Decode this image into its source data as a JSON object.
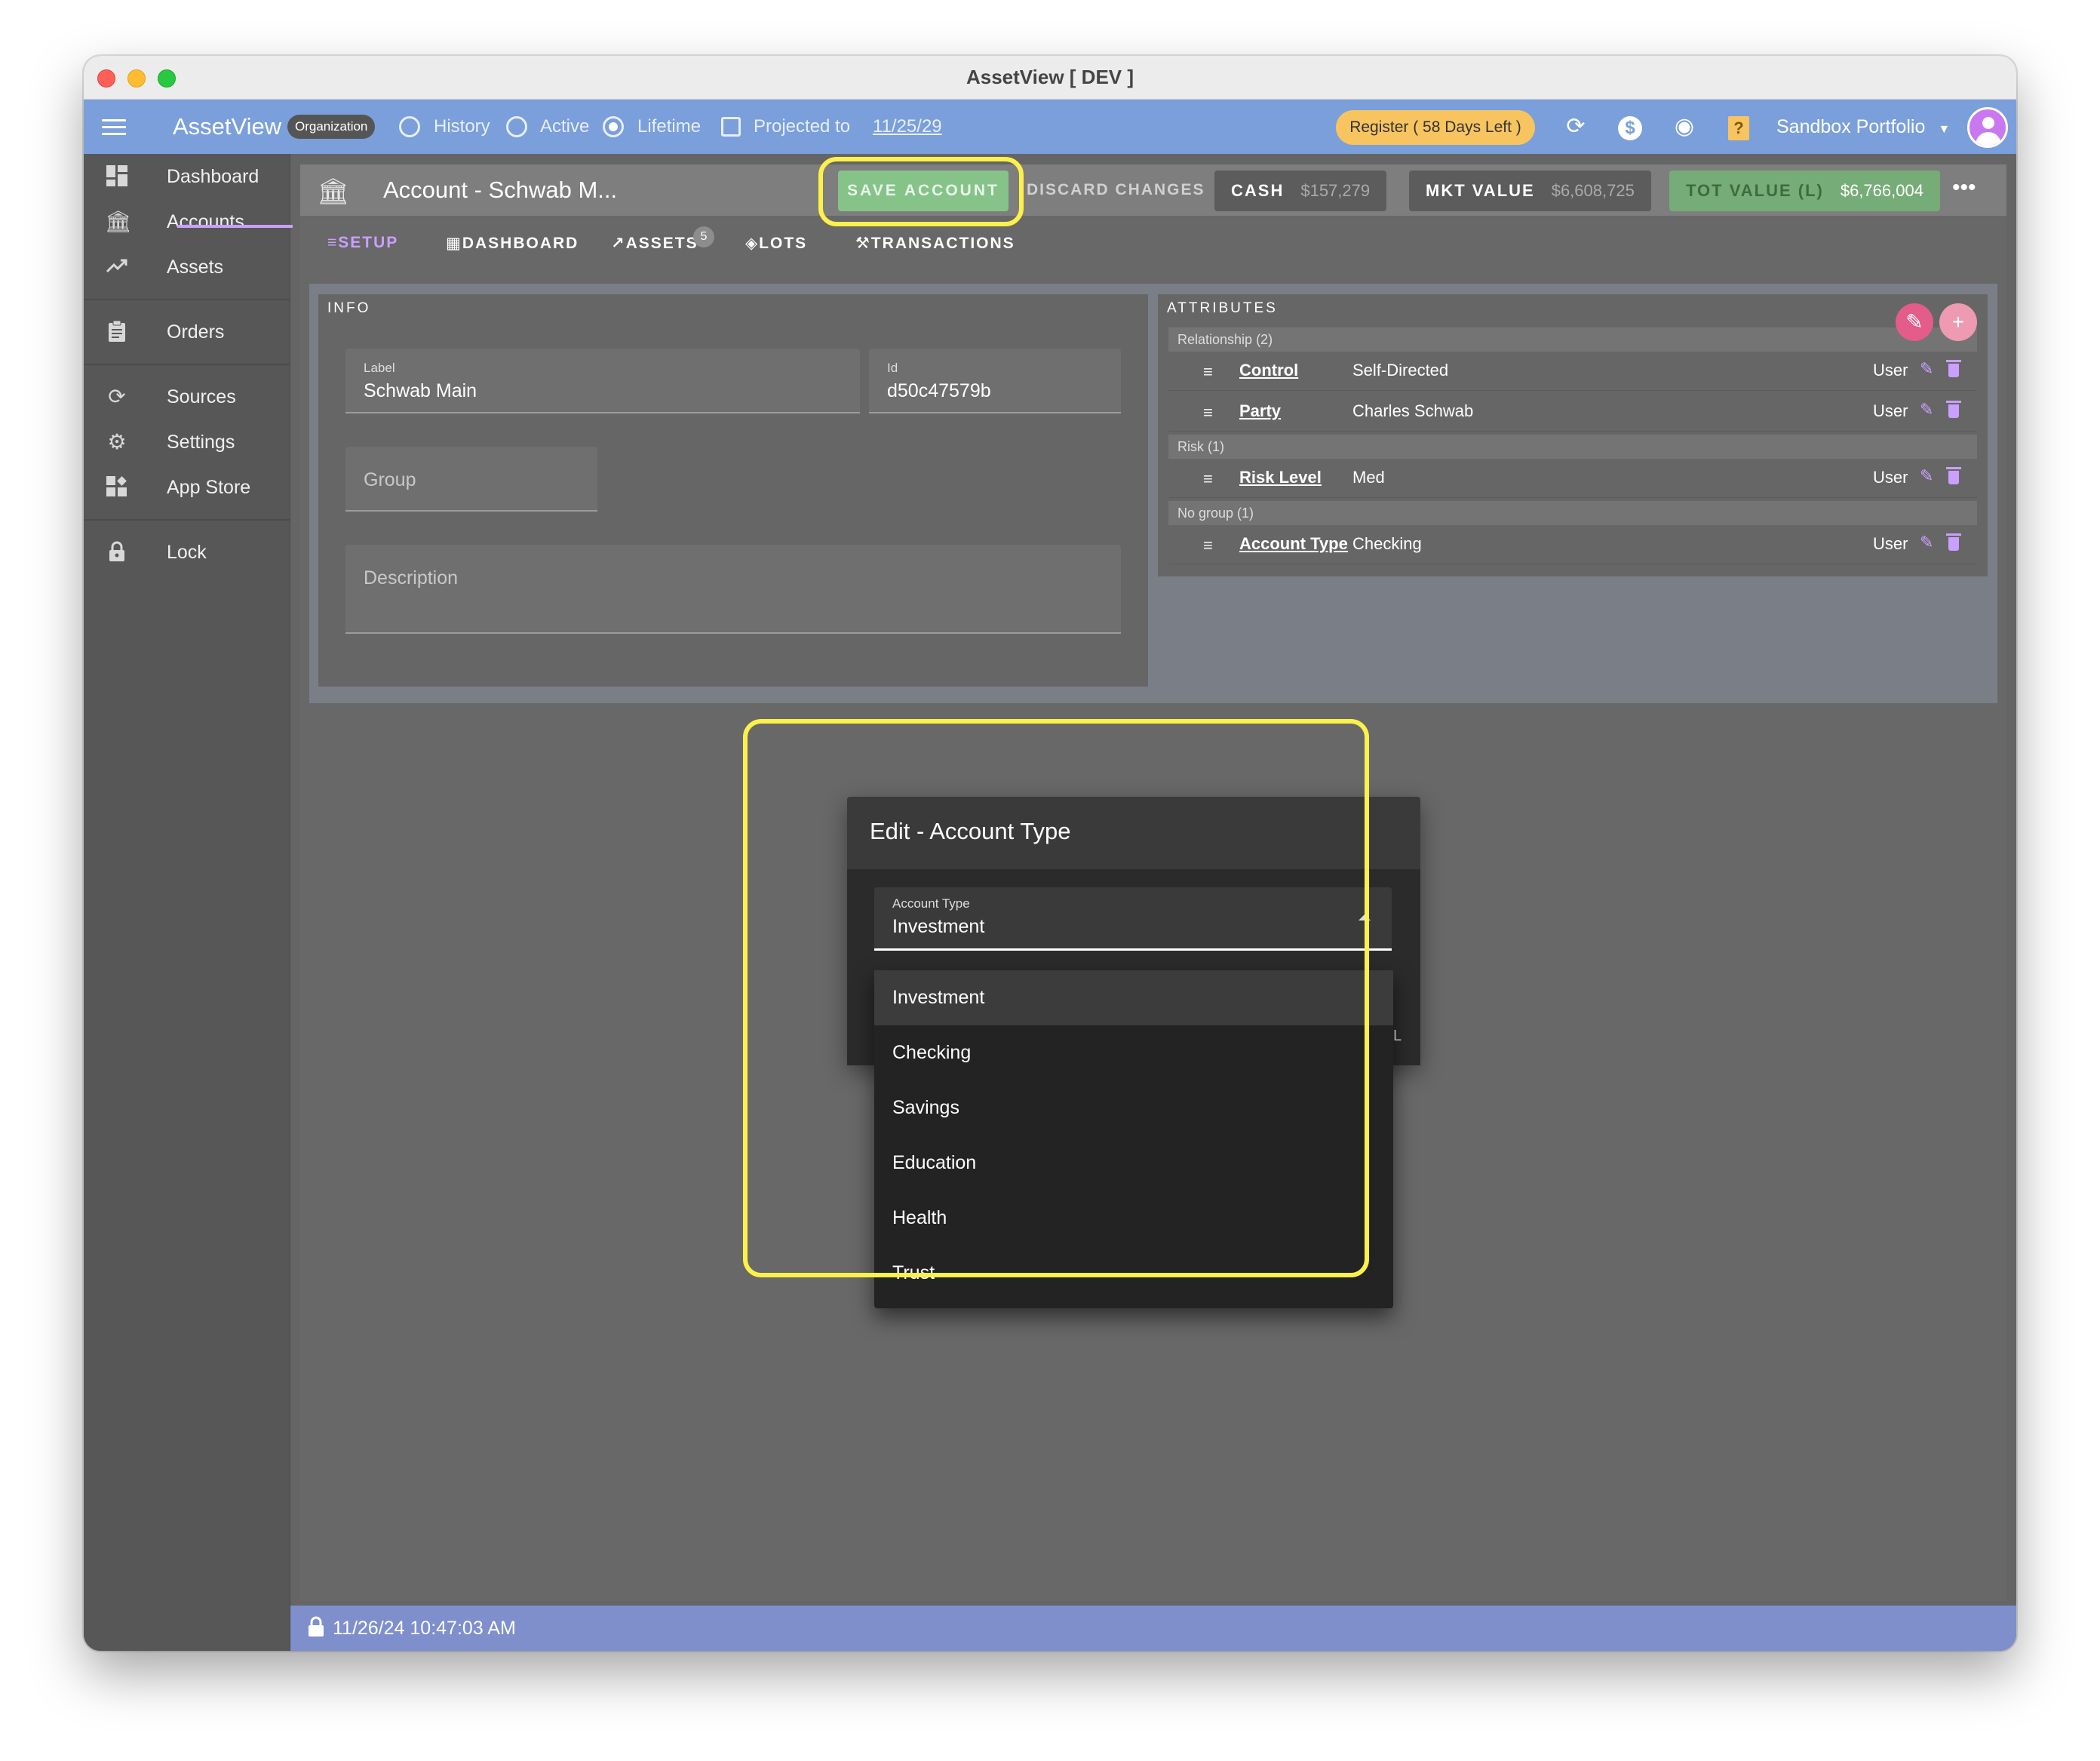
{
  "window": {
    "title": "AssetView [ DEV ]"
  },
  "appbar": {
    "brand": "AssetView",
    "org_chip": "Organization",
    "history": "History",
    "active": "Active",
    "lifetime": "Lifetime",
    "projected": "Projected to",
    "projected_date": "11/25/29",
    "register": "Register ( 58 Days Left )",
    "portfolio": "Sandbox Portfolio",
    "icons": [
      "menu-icon",
      "sync-icon",
      "dollar-icon",
      "eye-icon",
      "help-icon",
      "chevron-down-icon",
      "avatar-icon"
    ]
  },
  "sidebar": {
    "items": [
      {
        "label": "Dashboard",
        "icon": "dashboard-icon"
      },
      {
        "label": "Accounts",
        "icon": "bank-icon"
      },
      {
        "label": "Assets",
        "icon": "trending-up-icon"
      },
      {
        "label": "Orders",
        "icon": "clipboard-icon"
      },
      {
        "label": "Sources",
        "icon": "sync-icon"
      },
      {
        "label": "Settings",
        "icon": "gear-icon"
      },
      {
        "label": "App Store",
        "icon": "app-store-icon"
      },
      {
        "label": "Lock",
        "icon": "lock-icon"
      }
    ]
  },
  "account": {
    "title": "Account - Schwab M...",
    "save": "SAVE ACCOUNT",
    "discard": "DISCARD CHANGES",
    "cash_label": "CASH",
    "cash_value": "$157,279",
    "mkt_label": "MKT VALUE",
    "mkt_value": "$6,608,725",
    "tot_label": "TOT VALUE (L)",
    "tot_value": "$6,766,004"
  },
  "tabs": [
    {
      "label": "SETUP",
      "icon": "list-icon"
    },
    {
      "label": "DASHBOARD",
      "icon": "dashboard-icon"
    },
    {
      "label": "ASSETS",
      "icon": "trending-up-icon"
    },
    {
      "label": "LOTS",
      "icon": "layers-icon"
    },
    {
      "label": "TRANSACTIONS",
      "icon": "gavel-icon"
    }
  ],
  "assets_badge": "5",
  "info": {
    "title": "INFO",
    "label_label": "Label",
    "label_value": "Schwab Main",
    "id_label": "Id",
    "id_value": "d50c47579b",
    "group_placeholder": "Group",
    "description_placeholder": "Description"
  },
  "attributes": {
    "title": "ATTRIBUTES",
    "groups": [
      {
        "name": "Relationship (2)",
        "rows": [
          {
            "key": "Control",
            "value": "Self-Directed",
            "source": "User"
          },
          {
            "key": "Party",
            "value": "Charles Schwab",
            "source": "User"
          }
        ]
      },
      {
        "name": "Risk (1)",
        "rows": [
          {
            "key": "Risk Level",
            "value": "Med",
            "source": "User"
          }
        ]
      },
      {
        "name": "No group (1)",
        "rows": [
          {
            "key": "Account Type",
            "value": "Checking",
            "source": "User"
          }
        ]
      }
    ]
  },
  "dialog": {
    "title": "Edit - Account Type",
    "field_label": "Account Type",
    "field_value": "Investment",
    "fragment": "L",
    "options": [
      "Investment",
      "Checking",
      "Savings",
      "Education",
      "Health",
      "Trust"
    ],
    "highlighted_option": "Investment"
  },
  "status": {
    "timestamp": "11/26/24 10:47:03 AM"
  },
  "colors": {
    "appbar": "#7a9fdb",
    "accent": "#c9a0ff",
    "save_green": "#86c389",
    "highlight": "#fcf14b",
    "register_chip": "#f8c45f",
    "statusbar": "#7e8fcc"
  }
}
